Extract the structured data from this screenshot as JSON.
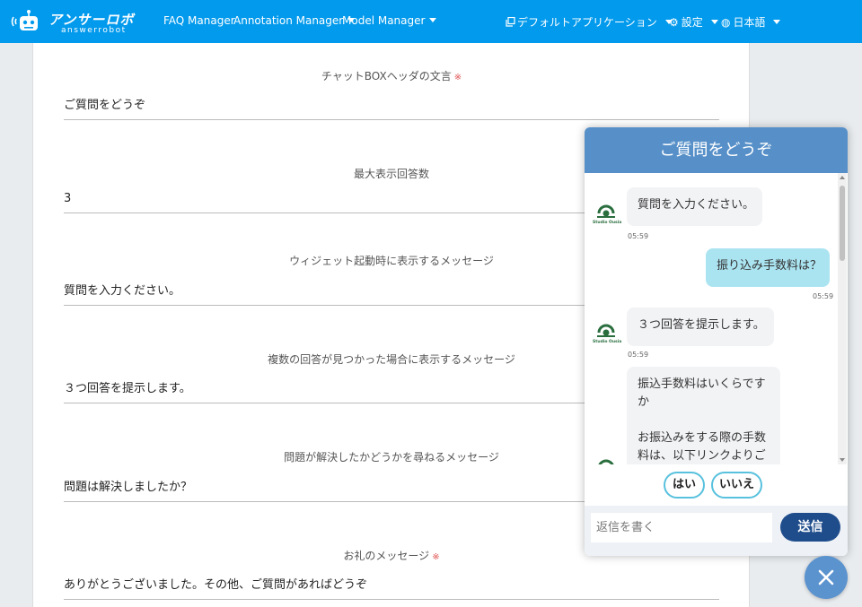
{
  "app": {
    "logo_title": "アンサーロボ",
    "logo_subtitle": "answerrobot"
  },
  "navbar": {
    "faq_manager": "FAQ Manager",
    "annotation_manager": "Annotation Manager",
    "model_manager": "Model Manager",
    "default_app": "デフォルトアプリケーション",
    "settings": "設定",
    "language": "日本語",
    "accent_color": "#029aed"
  },
  "form": {
    "required_mark": "※",
    "fields": [
      {
        "label": "チャットBOXヘッダの文言",
        "value": "ご質問をどうぞ",
        "required": true
      },
      {
        "label": "最大表示回答数",
        "value": "3",
        "required": false
      },
      {
        "label": "ウィジェット起動時に表示するメッセージ",
        "value": "質問を入力ください。",
        "required": false
      },
      {
        "label": "複数の回答が見つかった場合に表示するメッセージ",
        "value": "３つ回答を提示します。",
        "required": false
      },
      {
        "label": "問題が解決したかどうかを尋ねるメッセージ",
        "value": "問題は解決しましたか？",
        "required": false
      },
      {
        "label": "お礼のメッセージ",
        "value": "ありがとうございました。その他、ご質問があればどうぞ",
        "required": true
      }
    ]
  },
  "chat": {
    "header_title": "ご質問をどうぞ",
    "header_color": "#5790c8",
    "bot_name_caption": "Studio Ousia",
    "messages": [
      {
        "sender": "bot",
        "text": "質問を入力ください。",
        "time": "05:59"
      },
      {
        "sender": "user",
        "text": "振り込み手数料は？",
        "time": "05:59"
      },
      {
        "sender": "bot",
        "text": "３つ回答を提示します。",
        "time": "05:59"
      },
      {
        "sender": "bot",
        "text_line1": "振込手数料はいくらです",
        "text_line2": "か",
        "text_line3": "お振込みをする際の手数",
        "text_line4": "料は、以下リンクよりご"
      }
    ],
    "choices": {
      "yes": "はい",
      "no": "いいえ"
    },
    "input_placeholder": "返信を書く",
    "send_label": "送信",
    "close_icon": "close-icon"
  }
}
